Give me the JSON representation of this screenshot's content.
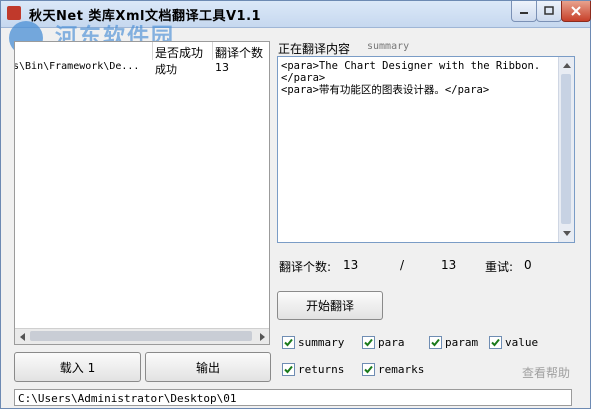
{
  "window": {
    "title": "秋天Net 类库Xml文档翻译工具V1.1"
  },
  "watermark": {
    "line1": "河东软件园",
    "line2": "www.pc0359.cn"
  },
  "list": {
    "columns": [
      "",
      "是否成功",
      "翻译个数"
    ],
    "rows": [
      {
        "path": "s\\Bin\\Framework\\De...",
        "status": "成功",
        "count": "13"
      }
    ]
  },
  "buttons": {
    "load": "载入 1",
    "output": "输出",
    "start": "开始翻译"
  },
  "path_field": "C:\\Users\\Administrator\\Desktop\\01",
  "translating": {
    "label": "正在翻译内容",
    "tag": "summary",
    "content": "<para>The Chart Designer with the Ribbon.</para>\n<para>带有功能区的图表设计器。</para>"
  },
  "stats": {
    "count_label": "翻译个数:",
    "done": "13",
    "separator": "/",
    "total": "13",
    "retry_label": "重试:",
    "retry": "0"
  },
  "options": [
    {
      "label": "summary",
      "checked": true
    },
    {
      "label": "para",
      "checked": true
    },
    {
      "label": "param",
      "checked": true
    },
    {
      "label": "value",
      "checked": true
    },
    {
      "label": "returns",
      "checked": true
    },
    {
      "label": "remarks",
      "checked": true
    }
  ],
  "help": "查看帮助",
  "colors": {
    "accent": "#4a8fd6",
    "check": "#1a7a1a",
    "close": "#c7402a"
  }
}
